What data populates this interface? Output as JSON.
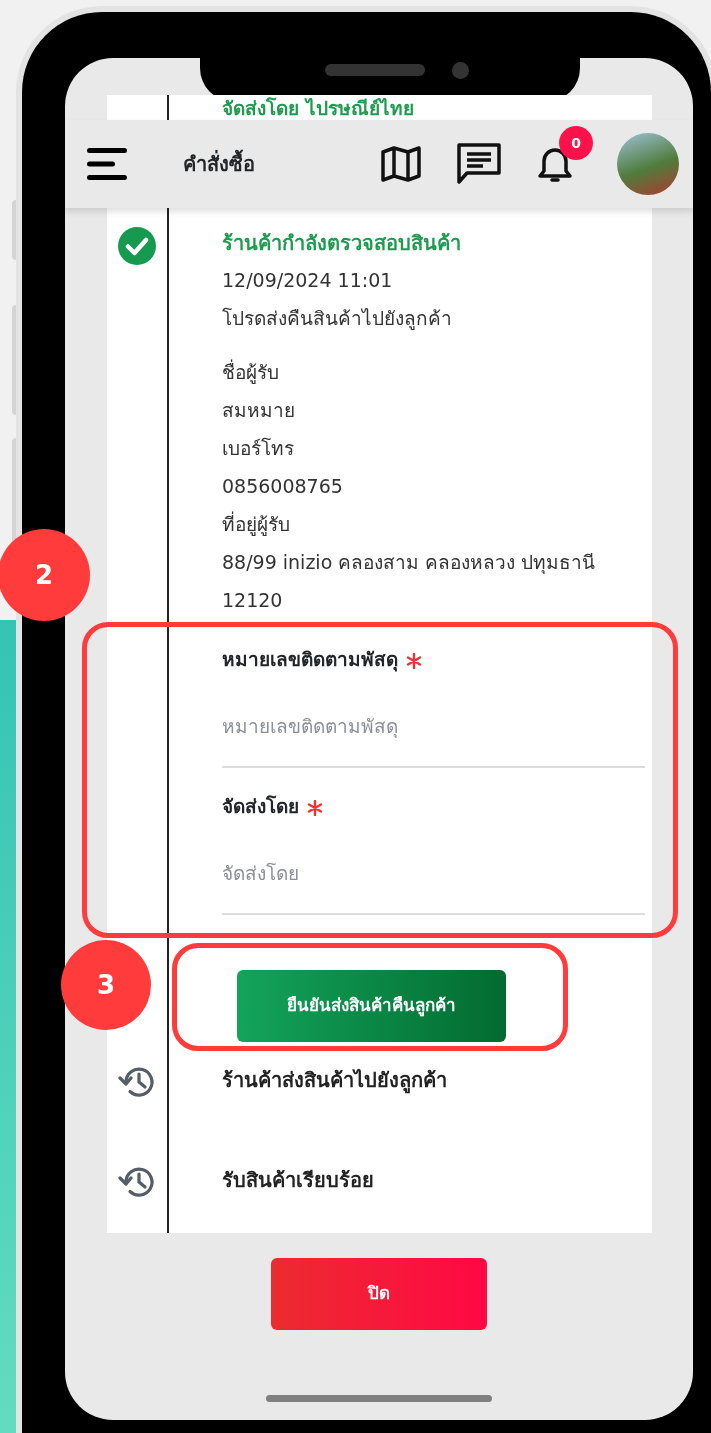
{
  "scrolled_text": "จัดส่งโดย ไปรษณีย์ไทย",
  "header": {
    "title": "คำสั่งซื้อ",
    "notification_count": "0"
  },
  "steps": [
    {
      "completed": true,
      "title": "ร้านค้ากำลังตรวจสอบสินค้า",
      "date": "12/09/2024 11:01",
      "note": "โปรดส่งคืนสินค้าไปยังลูกค้า",
      "details": [
        "ชื่อผู้รับ",
        "สมหมาย",
        "เบอร์โทร",
        "0856008765",
        "ที่อยู่ผู้รับ",
        "88/99 inizio คลองสาม คลองหลวง ปทุมธานี 12120"
      ],
      "form": {
        "fields": [
          {
            "label": "หมายเลขติดตามพัสดุ",
            "required": true,
            "placeholder": "หมายเลขติดตามพัสดุ"
          },
          {
            "label": "จัดส่งโดย",
            "required": true,
            "placeholder": "จัดส่งโดย"
          }
        ],
        "submit": "ยืนยันส่งสินค้าคืนลูกค้า"
      }
    },
    {
      "completed": false,
      "title": "ร้านค้าส่งสินค้าไปยังลูกค้า"
    },
    {
      "completed": false,
      "title": "รับสินค้าเรียบร้อย"
    }
  ],
  "close_button": "ปิด",
  "annotations": [
    {
      "label": "2"
    },
    {
      "label": "3"
    }
  ]
}
